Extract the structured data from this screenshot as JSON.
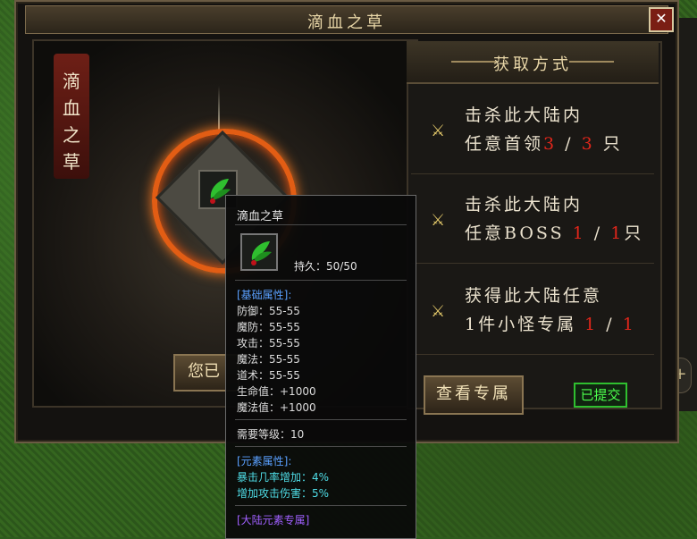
{
  "window": {
    "title": "滴血之草",
    "close_label": "✕"
  },
  "item": {
    "name_vertical": [
      "滴",
      "血",
      "之",
      "草"
    ]
  },
  "left_submit_partial": "您已",
  "acquire": {
    "title": "获取方式",
    "rows": [
      {
        "line1": "击杀此大陆内",
        "line2_pre": "任意首领",
        "cur": "3",
        "sep": "/",
        "total": "3",
        "unit": "只"
      },
      {
        "line1": "击杀此大陆内",
        "line2_pre": "任意BOSS",
        "cur": "1",
        "sep": "/",
        "total": "1",
        "unit": "只"
      },
      {
        "line1": "获得此大陆任意",
        "line2_pre": "1件小怪专属",
        "cur": "1",
        "sep": "/",
        "total": "1",
        "unit": ""
      }
    ],
    "view_button": "查看专属",
    "submitted": "已提交"
  },
  "tooltip": {
    "name": "滴血之草",
    "durability": "持久：50/50",
    "base_header": "[基础属性]:",
    "base_stats": [
      "防御：55-55",
      "魔防：55-55",
      "攻击：55-55",
      "魔法：55-55",
      "道术：55-55",
      "生命值：+1000",
      "魔法值：+1000"
    ],
    "required_level": "需要等级：10",
    "element_header": "[元素属性]:",
    "element_stats": [
      "暴击几率增加：4%",
      "增加攻击伤害：5%"
    ],
    "footer": "[大陆元素专属]"
  },
  "side": {
    "plus_label": "+"
  },
  "colors": {
    "accent_red": "#e0261b",
    "submitted_green": "#4dff4d",
    "ring_orange": "#e25d14"
  }
}
